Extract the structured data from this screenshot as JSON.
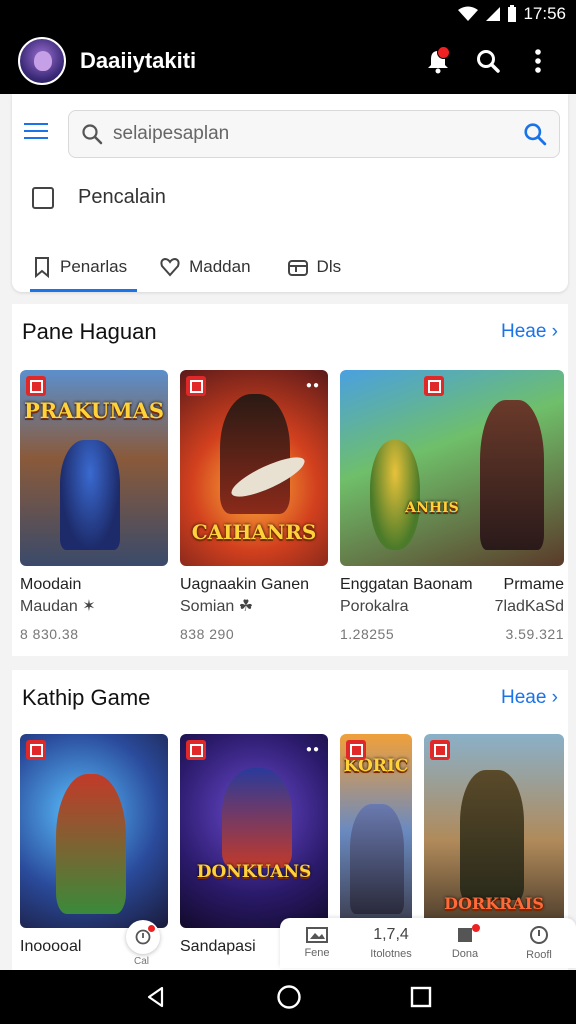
{
  "status": {
    "time": "17:56",
    "signal_icon": "wifi-icon",
    "battery_icon": "battery-icon"
  },
  "app_bar": {
    "title": "Daaiiytakiti",
    "icons": [
      "notification-icon",
      "search-icon",
      "more-vert-icon"
    ]
  },
  "search": {
    "placeholder": "selaipesaplan"
  },
  "checkbox": {
    "label": "Pencalain",
    "checked": false
  },
  "tabs": [
    {
      "label": "Penarlas",
      "icon": "bookmark-icon",
      "active": true
    },
    {
      "label": "Maddan",
      "icon": "heart-icon",
      "active": false
    },
    {
      "label": "Dls",
      "icon": "box-icon",
      "active": false
    }
  ],
  "section1": {
    "title": "Pane Haguan",
    "more": "Heae",
    "cards": [
      {
        "art_text": "PRAKUMAS",
        "title": "Moodain",
        "subtitle": "Maudan ✶",
        "count": "8 830.38"
      },
      {
        "art_text": "CAIHANRS",
        "title": "Uagnaakin Ganen",
        "subtitle": "Somian ☘",
        "count": "838 290"
      },
      {
        "art_text": "ANHIS",
        "title": "Enggatan Baonam",
        "subtitle": "Porokalra",
        "count": "1.28255"
      },
      {
        "art_text": "",
        "title": "Prmame",
        "subtitle": "7ladKaSd",
        "count": "3.59.321"
      }
    ]
  },
  "section2": {
    "title": "Kathip Game",
    "more": "Heae",
    "cards": [
      {
        "art_text": "",
        "title": "Inooooal"
      },
      {
        "art_text": "DONKUANS",
        "title": "Sandapasi"
      },
      {
        "art_text": "KORIC"
      },
      {
        "art_text": "DORKRAIS"
      }
    ]
  },
  "bottom_strip": [
    {
      "label": "Fene",
      "icon": "gallery-icon"
    },
    {
      "label": "Itolotnes",
      "icon": "number-icon",
      "text": "1,7,4"
    },
    {
      "label": "Dona",
      "icon": "bookmark-icon"
    },
    {
      "label": "Roofl",
      "icon": "info-icon"
    }
  ],
  "fab": {
    "label": "Cal"
  }
}
